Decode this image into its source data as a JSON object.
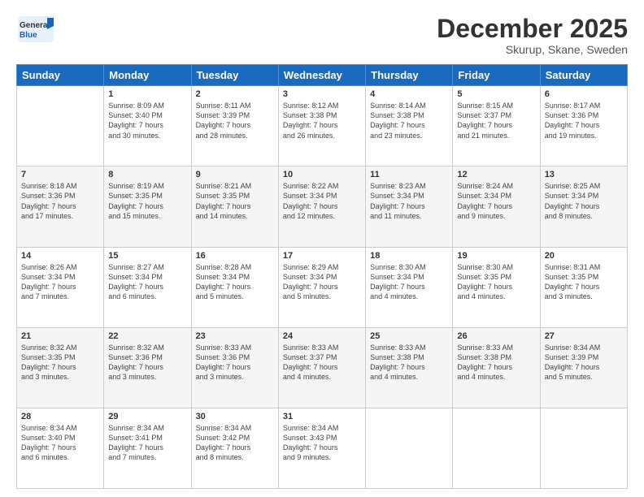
{
  "header": {
    "logo_general": "General",
    "logo_blue": "Blue",
    "title": "December 2025",
    "subtitle": "Skurup, Skane, Sweden"
  },
  "days_header": [
    "Sunday",
    "Monday",
    "Tuesday",
    "Wednesday",
    "Thursday",
    "Friday",
    "Saturday"
  ],
  "weeks": [
    [
      {
        "num": "",
        "info": ""
      },
      {
        "num": "1",
        "info": "Sunrise: 8:09 AM\nSunset: 3:40 PM\nDaylight: 7 hours\nand 30 minutes."
      },
      {
        "num": "2",
        "info": "Sunrise: 8:11 AM\nSunset: 3:39 PM\nDaylight: 7 hours\nand 28 minutes."
      },
      {
        "num": "3",
        "info": "Sunrise: 8:12 AM\nSunset: 3:38 PM\nDaylight: 7 hours\nand 26 minutes."
      },
      {
        "num": "4",
        "info": "Sunrise: 8:14 AM\nSunset: 3:38 PM\nDaylight: 7 hours\nand 23 minutes."
      },
      {
        "num": "5",
        "info": "Sunrise: 8:15 AM\nSunset: 3:37 PM\nDaylight: 7 hours\nand 21 minutes."
      },
      {
        "num": "6",
        "info": "Sunrise: 8:17 AM\nSunset: 3:36 PM\nDaylight: 7 hours\nand 19 minutes."
      }
    ],
    [
      {
        "num": "7",
        "info": "Sunrise: 8:18 AM\nSunset: 3:36 PM\nDaylight: 7 hours\nand 17 minutes."
      },
      {
        "num": "8",
        "info": "Sunrise: 8:19 AM\nSunset: 3:35 PM\nDaylight: 7 hours\nand 15 minutes."
      },
      {
        "num": "9",
        "info": "Sunrise: 8:21 AM\nSunset: 3:35 PM\nDaylight: 7 hours\nand 14 minutes."
      },
      {
        "num": "10",
        "info": "Sunrise: 8:22 AM\nSunset: 3:34 PM\nDaylight: 7 hours\nand 12 minutes."
      },
      {
        "num": "11",
        "info": "Sunrise: 8:23 AM\nSunset: 3:34 PM\nDaylight: 7 hours\nand 11 minutes."
      },
      {
        "num": "12",
        "info": "Sunrise: 8:24 AM\nSunset: 3:34 PM\nDaylight: 7 hours\nand 9 minutes."
      },
      {
        "num": "13",
        "info": "Sunrise: 8:25 AM\nSunset: 3:34 PM\nDaylight: 7 hours\nand 8 minutes."
      }
    ],
    [
      {
        "num": "14",
        "info": "Sunrise: 8:26 AM\nSunset: 3:34 PM\nDaylight: 7 hours\nand 7 minutes."
      },
      {
        "num": "15",
        "info": "Sunrise: 8:27 AM\nSunset: 3:34 PM\nDaylight: 7 hours\nand 6 minutes."
      },
      {
        "num": "16",
        "info": "Sunrise: 8:28 AM\nSunset: 3:34 PM\nDaylight: 7 hours\nand 5 minutes."
      },
      {
        "num": "17",
        "info": "Sunrise: 8:29 AM\nSunset: 3:34 PM\nDaylight: 7 hours\nand 5 minutes."
      },
      {
        "num": "18",
        "info": "Sunrise: 8:30 AM\nSunset: 3:34 PM\nDaylight: 7 hours\nand 4 minutes."
      },
      {
        "num": "19",
        "info": "Sunrise: 8:30 AM\nSunset: 3:35 PM\nDaylight: 7 hours\nand 4 minutes."
      },
      {
        "num": "20",
        "info": "Sunrise: 8:31 AM\nSunset: 3:35 PM\nDaylight: 7 hours\nand 3 minutes."
      }
    ],
    [
      {
        "num": "21",
        "info": "Sunrise: 8:32 AM\nSunset: 3:35 PM\nDaylight: 7 hours\nand 3 minutes."
      },
      {
        "num": "22",
        "info": "Sunrise: 8:32 AM\nSunset: 3:36 PM\nDaylight: 7 hours\nand 3 minutes."
      },
      {
        "num": "23",
        "info": "Sunrise: 8:33 AM\nSunset: 3:36 PM\nDaylight: 7 hours\nand 3 minutes."
      },
      {
        "num": "24",
        "info": "Sunrise: 8:33 AM\nSunset: 3:37 PM\nDaylight: 7 hours\nand 4 minutes."
      },
      {
        "num": "25",
        "info": "Sunrise: 8:33 AM\nSunset: 3:38 PM\nDaylight: 7 hours\nand 4 minutes."
      },
      {
        "num": "26",
        "info": "Sunrise: 8:33 AM\nSunset: 3:38 PM\nDaylight: 7 hours\nand 4 minutes."
      },
      {
        "num": "27",
        "info": "Sunrise: 8:34 AM\nSunset: 3:39 PM\nDaylight: 7 hours\nand 5 minutes."
      }
    ],
    [
      {
        "num": "28",
        "info": "Sunrise: 8:34 AM\nSunset: 3:40 PM\nDaylight: 7 hours\nand 6 minutes."
      },
      {
        "num": "29",
        "info": "Sunrise: 8:34 AM\nSunset: 3:41 PM\nDaylight: 7 hours\nand 7 minutes."
      },
      {
        "num": "30",
        "info": "Sunrise: 8:34 AM\nSunset: 3:42 PM\nDaylight: 7 hours\nand 8 minutes."
      },
      {
        "num": "31",
        "info": "Sunrise: 8:34 AM\nSunset: 3:43 PM\nDaylight: 7 hours\nand 9 minutes."
      },
      {
        "num": "",
        "info": ""
      },
      {
        "num": "",
        "info": ""
      },
      {
        "num": "",
        "info": ""
      }
    ]
  ]
}
